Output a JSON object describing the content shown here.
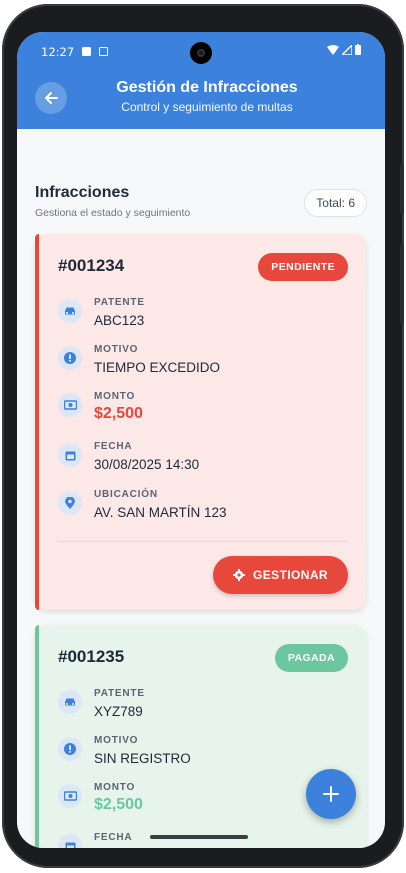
{
  "status_bar": {
    "time": "12:27"
  },
  "header": {
    "title": "Gestión de Infracciones",
    "subtitle": "Control y seguimiento de multas"
  },
  "section": {
    "title": "Infracciones",
    "subtitle": "Gestiona el estado y seguimiento",
    "total_label": "Total: 6"
  },
  "infractions": [
    {
      "number": "#001234",
      "status": "PENDIENTE",
      "fields": {
        "patente": {
          "label": "PATENTE",
          "value": "ABC123",
          "icon": "car-icon"
        },
        "motivo": {
          "label": "MOTIVO",
          "value": "TIEMPO EXCEDIDO",
          "icon": "alert-icon"
        },
        "monto": {
          "label": "MONTO",
          "value": "$2,500",
          "icon": "money-icon"
        },
        "fecha": {
          "label": "FECHA",
          "value": "30/08/2025 14:30",
          "icon": "calendar-icon"
        },
        "ubicacion": {
          "label": "UBICACIÓN",
          "value": "AV. SAN MARTÍN 123",
          "icon": "location-pin-icon"
        }
      },
      "action_label": "GESTIONAR"
    },
    {
      "number": "#001235",
      "status": "PAGADA",
      "fields": {
        "patente": {
          "label": "PATENTE",
          "value": "XYZ789",
          "icon": "car-icon"
        },
        "motivo": {
          "label": "MOTIVO",
          "value": "SIN REGISTRO",
          "icon": "alert-icon"
        },
        "monto": {
          "label": "MONTO",
          "value": "$2,500",
          "icon": "money-icon"
        },
        "fecha": {
          "label": "FECHA",
          "value": "",
          "icon": "calendar-icon"
        }
      }
    }
  ],
  "colors": {
    "primary": "#3c82dc",
    "pending": "#e8473c",
    "pending_bg": "#fde8e8",
    "paid": "#6cc7a0",
    "paid_bg": "#e6f4ec"
  }
}
